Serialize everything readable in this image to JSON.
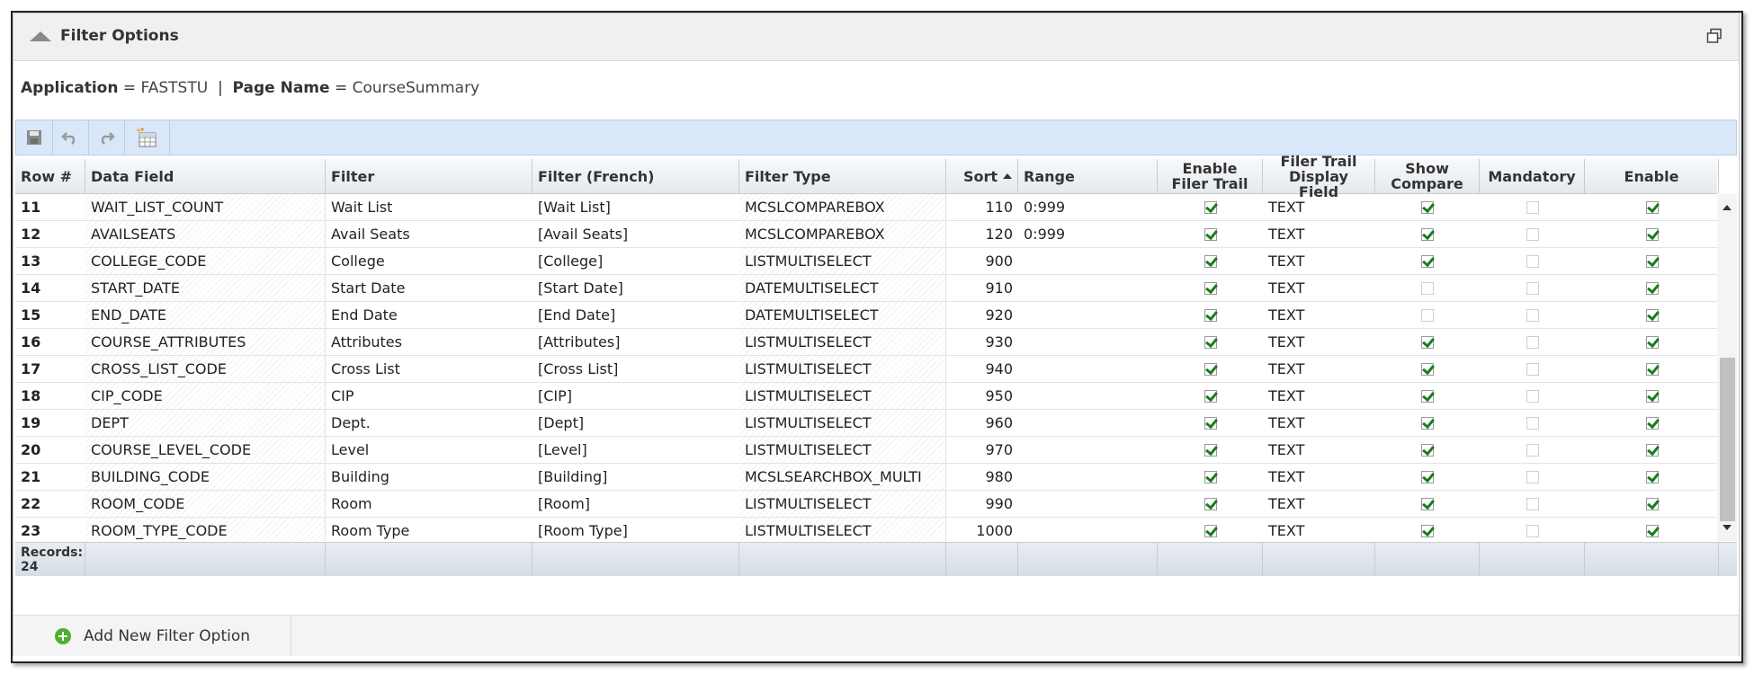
{
  "panel": {
    "title": "Filter Options"
  },
  "crumbs": {
    "app_label": "Application",
    "app_value": "FASTSTU",
    "separator": "|",
    "page_label": "Page Name",
    "page_value": "CourseSummary",
    "equals": "="
  },
  "toolbar": {
    "buttons": [
      "save-icon",
      "undo-icon",
      "redo-icon",
      "export-grid-icon"
    ]
  },
  "grid": {
    "columns": {
      "row": "Row #",
      "data_field": "Data Field",
      "filter": "Filter",
      "filter_fr": "Filter (French)",
      "filter_type": "Filter Type",
      "sort": "Sort",
      "range": "Range",
      "enable_trail": "Enable Filer Trail",
      "trail_display": "Filer Trail Display Field",
      "show_compare": "Show Compare",
      "mandatory": "Mandatory",
      "enable": "Enable"
    },
    "sort_column": "sort",
    "sort_direction": "ascending",
    "rows": [
      {
        "n": "11",
        "field": "WAIT_LIST_COUNT",
        "filter": "Wait List",
        "filter_fr": "[Wait List]",
        "type": "MCSLCOMPAREBOX",
        "sort": "110",
        "range": "0:999",
        "trail": true,
        "display": "TEXT",
        "compare": true,
        "mandatory": false,
        "enable": true
      },
      {
        "n": "12",
        "field": "AVAILSEATS",
        "filter": "Avail Seats",
        "filter_fr": "[Avail Seats]",
        "type": "MCSLCOMPAREBOX",
        "sort": "120",
        "range": "0:999",
        "trail": true,
        "display": "TEXT",
        "compare": true,
        "mandatory": false,
        "enable": true
      },
      {
        "n": "13",
        "field": "COLLEGE_CODE",
        "filter": "College",
        "filter_fr": "[College]",
        "type": "LISTMULTISELECT",
        "sort": "900",
        "range": "",
        "trail": true,
        "display": "TEXT",
        "compare": true,
        "mandatory": false,
        "enable": true
      },
      {
        "n": "14",
        "field": "START_DATE",
        "filter": "Start Date",
        "filter_fr": "[Start Date]",
        "type": "DATEMULTISELECT",
        "sort": "910",
        "range": "",
        "trail": true,
        "display": "TEXT",
        "compare": false,
        "mandatory": false,
        "enable": true
      },
      {
        "n": "15",
        "field": "END_DATE",
        "filter": "End Date",
        "filter_fr": "[End Date]",
        "type": "DATEMULTISELECT",
        "sort": "920",
        "range": "",
        "trail": true,
        "display": "TEXT",
        "compare": false,
        "mandatory": false,
        "enable": true
      },
      {
        "n": "16",
        "field": "COURSE_ATTRIBUTES",
        "filter": "Attributes",
        "filter_fr": "[Attributes]",
        "type": "LISTMULTISELECT",
        "sort": "930",
        "range": "",
        "trail": true,
        "display": "TEXT",
        "compare": true,
        "mandatory": false,
        "enable": true
      },
      {
        "n": "17",
        "field": "CROSS_LIST_CODE",
        "filter": "Cross List",
        "filter_fr": "[Cross List]",
        "type": "LISTMULTISELECT",
        "sort": "940",
        "range": "",
        "trail": true,
        "display": "TEXT",
        "compare": true,
        "mandatory": false,
        "enable": true
      },
      {
        "n": "18",
        "field": "CIP_CODE",
        "filter": "CIP",
        "filter_fr": "[CIP]",
        "type": "LISTMULTISELECT",
        "sort": "950",
        "range": "",
        "trail": true,
        "display": "TEXT",
        "compare": true,
        "mandatory": false,
        "enable": true
      },
      {
        "n": "19",
        "field": "DEPT",
        "filter": "Dept.",
        "filter_fr": "[Dept]",
        "type": "LISTMULTISELECT",
        "sort": "960",
        "range": "",
        "trail": true,
        "display": "TEXT",
        "compare": true,
        "mandatory": false,
        "enable": true
      },
      {
        "n": "20",
        "field": "COURSE_LEVEL_CODE",
        "filter": "Level",
        "filter_fr": "[Level]",
        "type": "LISTMULTISELECT",
        "sort": "970",
        "range": "",
        "trail": true,
        "display": "TEXT",
        "compare": true,
        "mandatory": false,
        "enable": true
      },
      {
        "n": "21",
        "field": "BUILDING_CODE",
        "filter": "Building",
        "filter_fr": "[Building]",
        "type": "MCSLSEARCHBOX_MULTI",
        "sort": "980",
        "range": "",
        "trail": true,
        "display": "TEXT",
        "compare": true,
        "mandatory": false,
        "enable": true
      },
      {
        "n": "22",
        "field": "ROOM_CODE",
        "filter": "Room",
        "filter_fr": "[Room]",
        "type": "LISTMULTISELECT",
        "sort": "990",
        "range": "",
        "trail": true,
        "display": "TEXT",
        "compare": true,
        "mandatory": false,
        "enable": true
      },
      {
        "n": "23",
        "field": "ROOM_TYPE_CODE",
        "filter": "Room Type",
        "filter_fr": "[Room Type]",
        "type": "LISTMULTISELECT",
        "sort": "1000",
        "range": "",
        "trail": true,
        "display": "TEXT",
        "compare": true,
        "mandatory": false,
        "enable": true
      }
    ],
    "records_label": "Records:",
    "records_count": "24"
  },
  "bottom": {
    "add_label": "Add New Filter Option"
  }
}
